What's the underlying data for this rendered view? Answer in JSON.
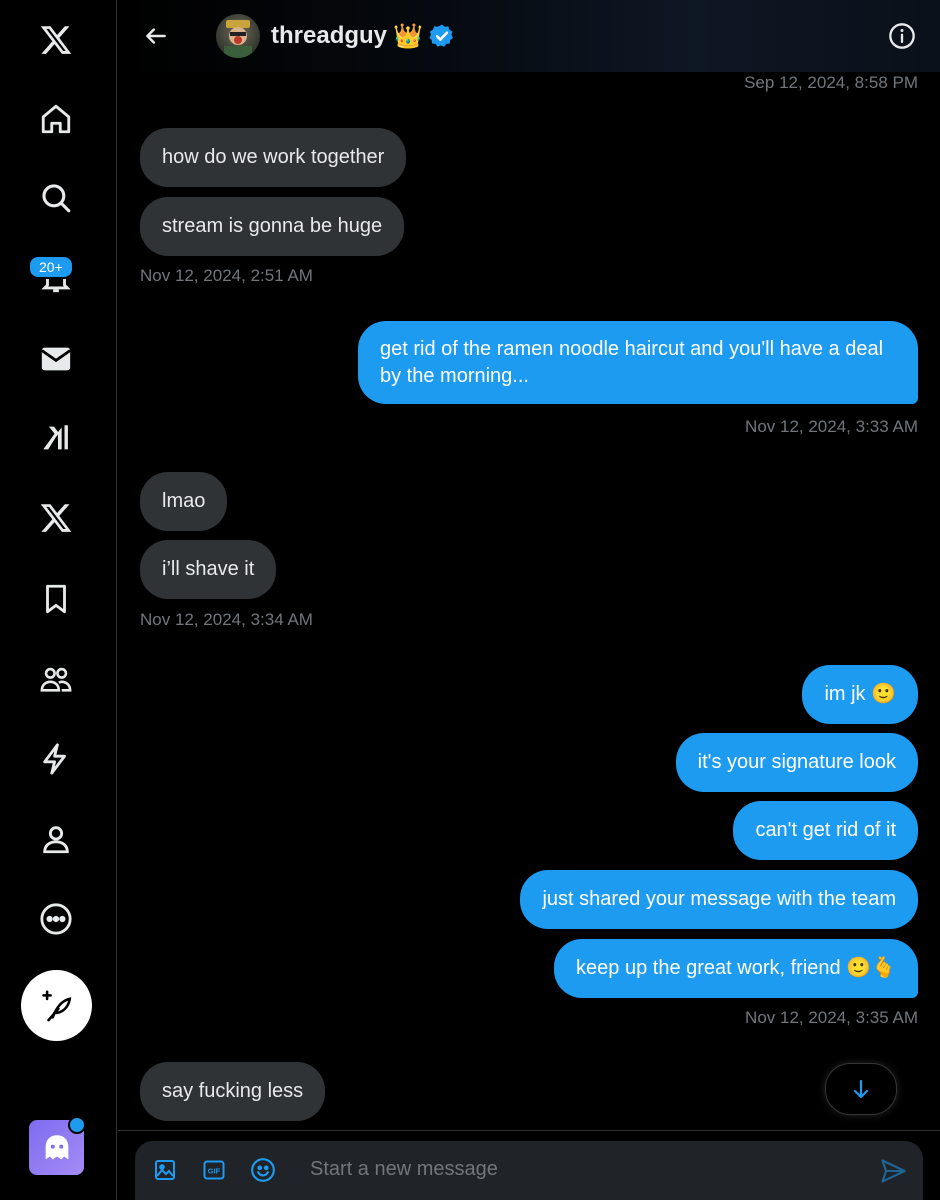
{
  "sidebar": {
    "notification_badge": "20+"
  },
  "header": {
    "username": "threadguy",
    "name_emoji": "👑"
  },
  "messages": [
    {
      "text": "how do we work together"
    },
    {
      "text": "stream is gonna be huge"
    },
    {
      "text": "get rid of the ramen noodle haircut and you'll have a deal by the morning..."
    },
    {
      "text": "lmao"
    },
    {
      "text": "i’ll shave it"
    },
    {
      "text": "im jk 🙂"
    },
    {
      "text": "it's your signature look"
    },
    {
      "text": "can't get rid of it"
    },
    {
      "text": "just shared your message with the team"
    },
    {
      "text": "keep up the great work, friend 🙂🫰"
    },
    {
      "text": "say fucking less"
    }
  ],
  "timestamps": [
    "Sep 12, 2024, 8:58 PM",
    "Nov 12, 2024, 2:51 AM",
    "Nov 12, 2024, 3:33 AM",
    "Nov 12, 2024, 3:34 AM",
    "Nov 12, 2024, 3:35 AM"
  ],
  "composer": {
    "placeholder": "Start a new message"
  },
  "colors": {
    "accent": "#1d9bf0",
    "incoming_bubble": "#2f3336",
    "background": "#000000"
  }
}
